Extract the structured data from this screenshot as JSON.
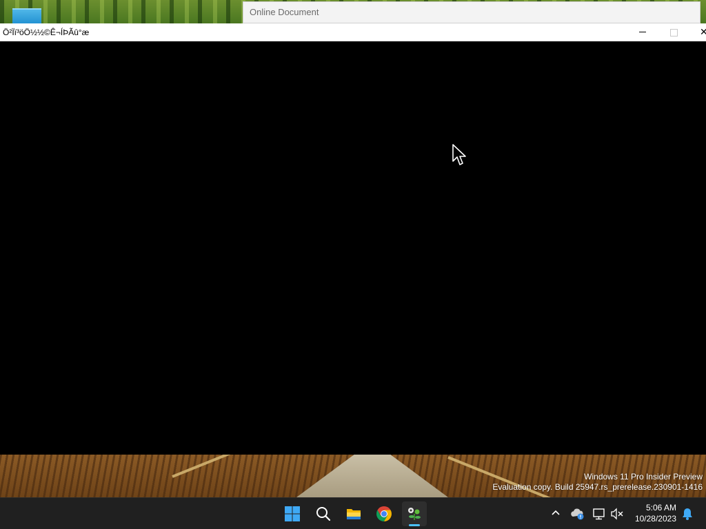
{
  "desktop": {
    "watermark_line1": "Windows 11 Pro Insider Preview",
    "watermark_line2": "Evaluation copy. Build 25947.rs_prerelease.230901-1416"
  },
  "background_window": {
    "title": "Online Document"
  },
  "main_window": {
    "title": "Ö²Ïï³öÖ½½©Ê¬ÍÞÃû°æ",
    "minimize_glyph": "—",
    "close_glyph": "✕"
  },
  "taskbar": {
    "items": [
      {
        "name": "start",
        "icon": "windows-logo-icon"
      },
      {
        "name": "search",
        "icon": "search-icon"
      },
      {
        "name": "file-explorer",
        "icon": "folder-icon"
      },
      {
        "name": "chrome",
        "icon": "chrome-icon"
      },
      {
        "name": "game-app",
        "icon": "plant-app-icon",
        "active": true
      }
    ],
    "tray": {
      "chevron_icon": "chevron-up-icon",
      "icons": [
        "onedrive-icon",
        "network-icon",
        "volume-muted-icon"
      ],
      "time": "5:06 AM",
      "date": "10/28/2023",
      "notification_icon": "bell-icon"
    }
  },
  "colors": {
    "accent": "#4cc2ff",
    "taskbar_bg": "#202020",
    "window_content": "#000000"
  }
}
